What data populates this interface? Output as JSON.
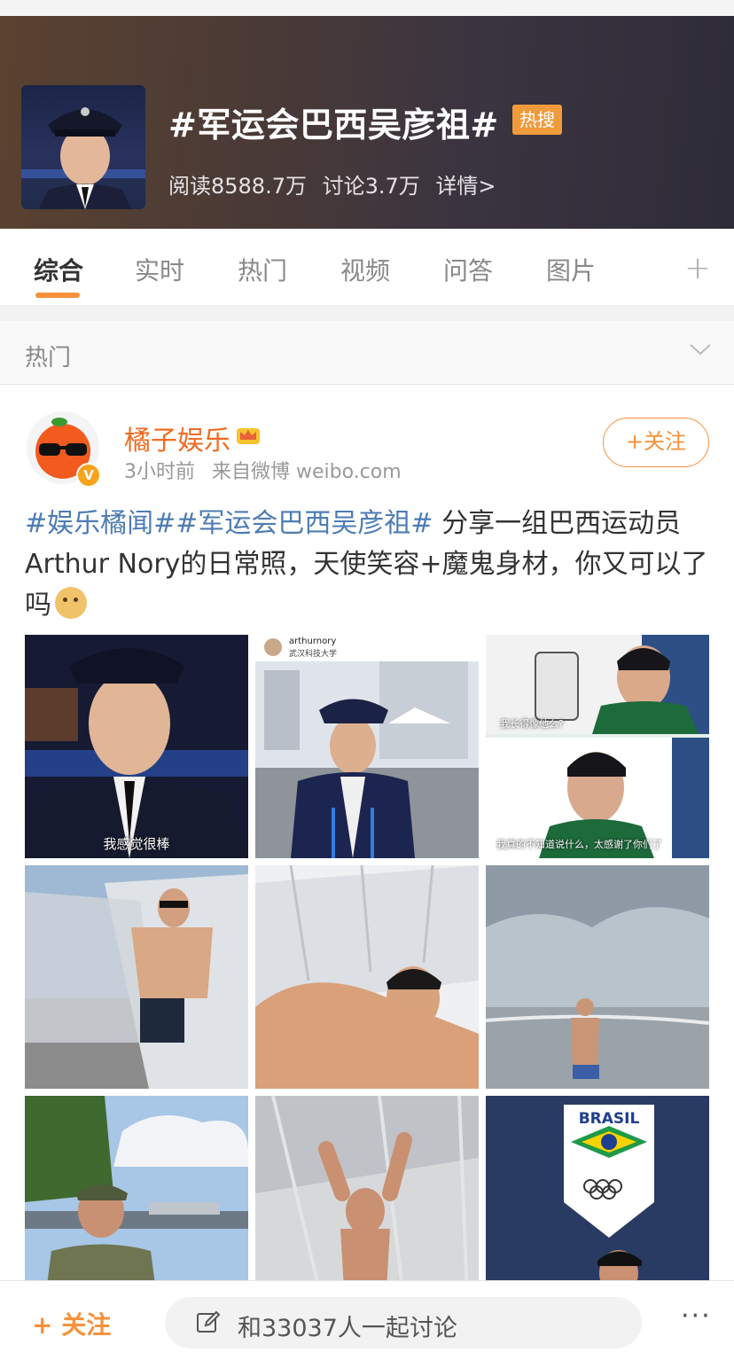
{
  "topic": {
    "title": "#军运会巴西吴彦祖#",
    "hot_badge": "热搜",
    "reads": "阅读8588.7万",
    "discussions": "讨论3.7万",
    "details_link": "详情>"
  },
  "tabs": [
    {
      "label": "综合",
      "active": true
    },
    {
      "label": "实时",
      "active": false
    },
    {
      "label": "热门",
      "active": false
    },
    {
      "label": "视频",
      "active": false
    },
    {
      "label": "问答",
      "active": false
    },
    {
      "label": "图片",
      "active": false
    }
  ],
  "tab_add_icon": "plus-icon",
  "section": {
    "label": "热门",
    "icon": "chevron-down-icon"
  },
  "post": {
    "author": "橘子娱乐",
    "author_badge_icon": "crown-icon",
    "verified_badge": "V",
    "time": "3小时前",
    "source": "来自微博 weibo.com",
    "follow_label": "+关注",
    "text": {
      "tag1": "#娱乐橘闻#",
      "tag2": "#军运会巴西吴彦祖#",
      "body": " 分享一组巴西运动员Arthur Nory的日常照，天使笑容+魔鬼身材，你又可以了吗",
      "emoji": "doge-emoji"
    },
    "images": [
      {
        "caption": "我感觉很棒"
      },
      {
        "caption": "",
        "account": "arthurnory",
        "location": "武汉科技大学"
      },
      {
        "caption_top": "我长得像他么?",
        "caption": "我真的不知道说什么，太感谢了你们了"
      },
      {
        "caption": ""
      },
      {
        "caption": ""
      },
      {
        "caption": ""
      },
      {
        "caption": ""
      },
      {
        "caption": ""
      },
      {
        "caption": "",
        "logo_text": "BRASIL"
      }
    ]
  },
  "bottom_bar": {
    "follow_label": "+ 关注",
    "discuss_placeholder": "和33037人一起讨论",
    "more_label": "···"
  }
}
